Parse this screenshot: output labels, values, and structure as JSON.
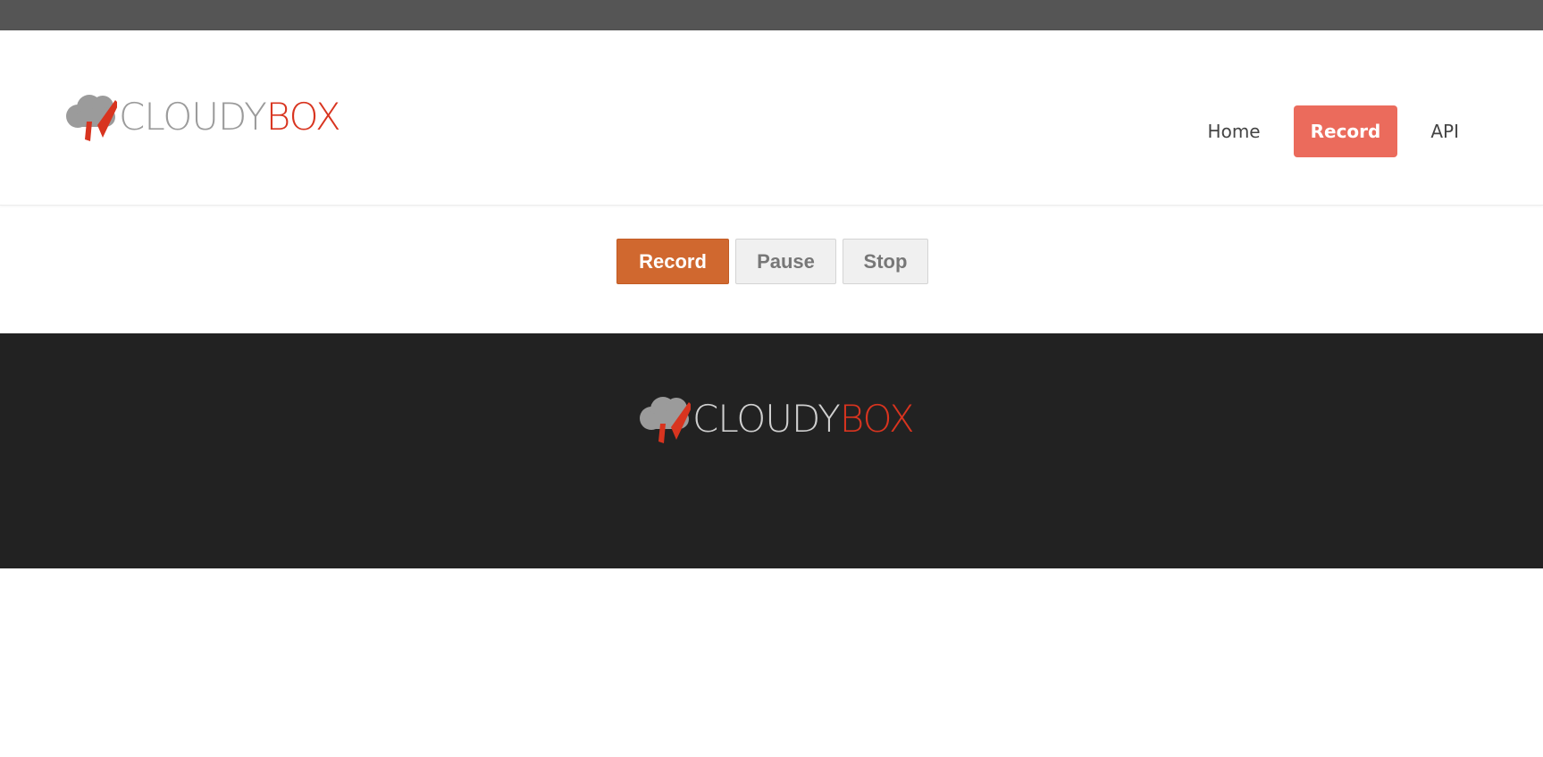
{
  "brand": {
    "word1": "CLOUDY",
    "word2": "BOX",
    "logo_icon": "cloud-logo-icon",
    "colors": {
      "gray": "#9b9b9b",
      "red": "#d8341f"
    }
  },
  "nav": {
    "items": [
      {
        "label": "Home"
      },
      {
        "label": "Record",
        "active": true
      },
      {
        "label": "API"
      }
    ],
    "active_color": "#eb6b5c"
  },
  "controls": {
    "record_label": "Record",
    "pause_label": "Pause",
    "stop_label": "Stop",
    "record_color": "#d0682f"
  },
  "colors": {
    "top_bar": "#555555",
    "footer": "#222222"
  }
}
